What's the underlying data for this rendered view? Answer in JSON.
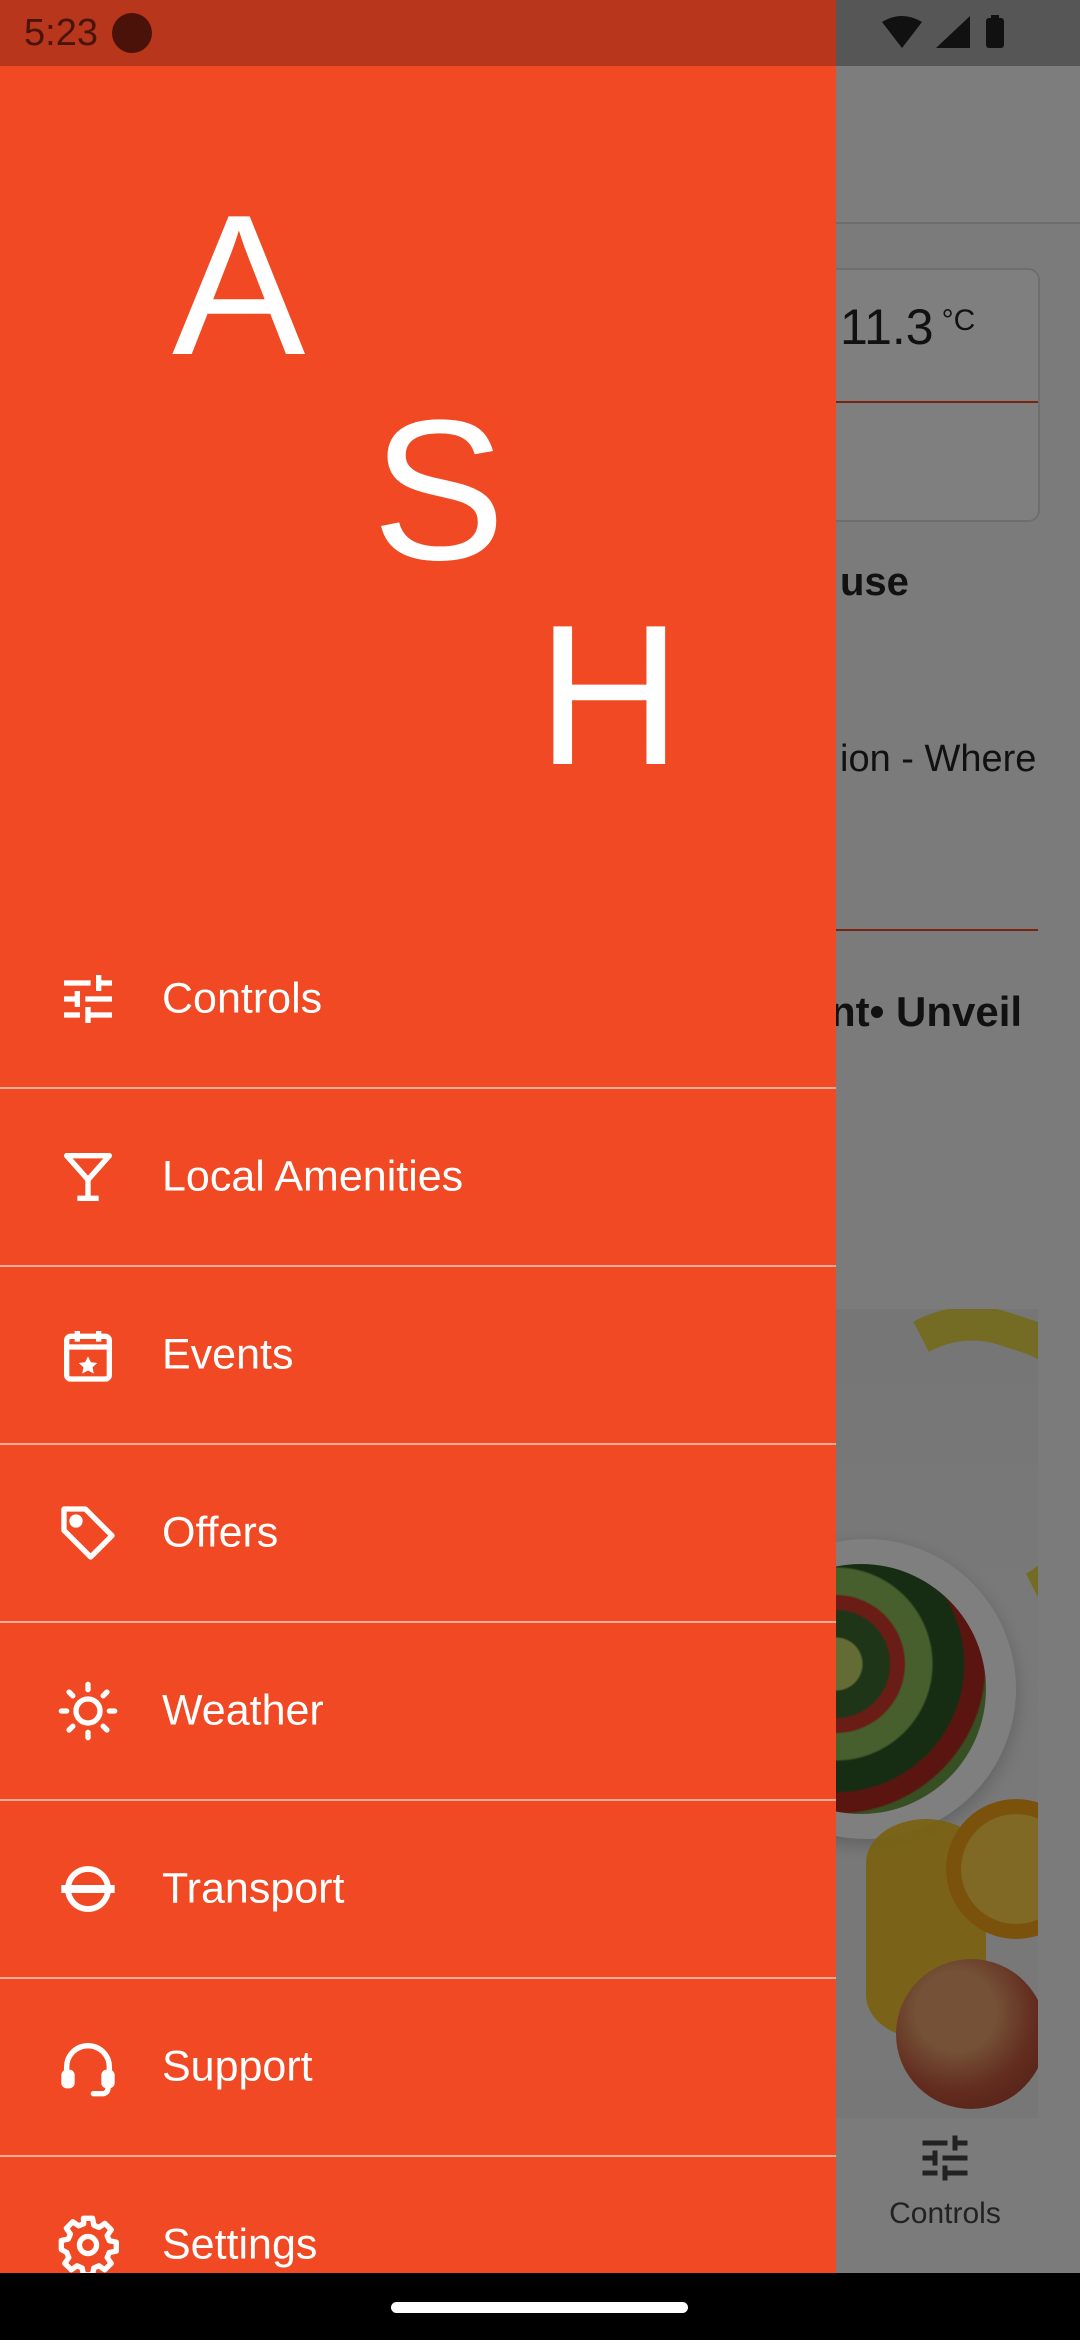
{
  "status_bar": {
    "time": "5:23"
  },
  "background_app": {
    "temperature": "11.3",
    "temperature_unit": "°C",
    "heading_1": "use",
    "text_1": "ion - Where",
    "heading_2": "nt• Unveil",
    "bottom_nav": {
      "controls_label": "Controls"
    }
  },
  "drawer": {
    "logo_letters": [
      "A",
      "S",
      "H"
    ],
    "menu": [
      {
        "label": "Controls",
        "icon": "sliders-icon"
      },
      {
        "label": "Local Amenities",
        "icon": "cocktail-icon"
      },
      {
        "label": "Events",
        "icon": "calendar-star-icon"
      },
      {
        "label": "Offers",
        "icon": "tag-icon"
      },
      {
        "label": "Weather",
        "icon": "sun-icon"
      },
      {
        "label": "Transport",
        "icon": "transport-roundel-icon"
      },
      {
        "label": "Support",
        "icon": "headset-icon"
      },
      {
        "label": "Settings",
        "icon": "gear-icon"
      }
    ]
  },
  "colors": {
    "accent": "#F04923",
    "status_bar_drawer": "#B7361C",
    "text_on_accent": "#FFFFFF"
  }
}
